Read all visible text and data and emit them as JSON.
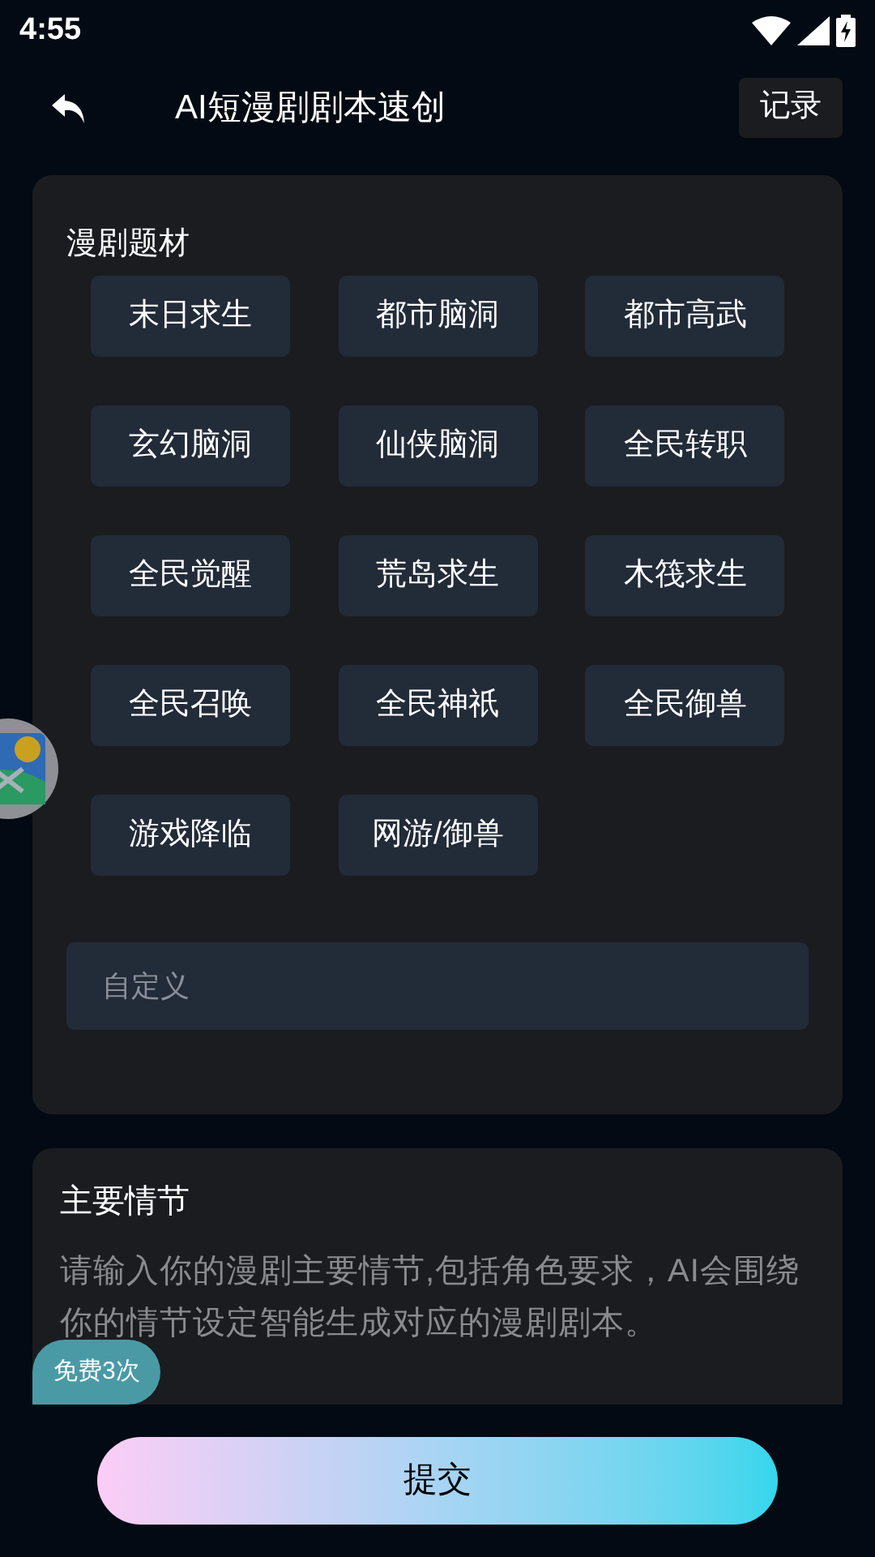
{
  "status_bar": {
    "time": "4:55"
  },
  "header": {
    "title": "AI短漫剧剧本速创",
    "records_button": "记录"
  },
  "genre_card": {
    "title": "漫剧题材",
    "genres": [
      "末日求生",
      "都市脑洞",
      "都市高武",
      "玄幻脑洞",
      "仙侠脑洞",
      "全民转职",
      "全民觉醒",
      "荒岛求生",
      "木筏求生",
      "全民召唤",
      "全民神祇",
      "全民御兽",
      "游戏降临",
      "网游/御兽"
    ],
    "custom_field": {
      "placeholder": "自定义"
    }
  },
  "plot_card": {
    "title": "主要情节",
    "plot_field": {
      "placeholder": "请输入你的漫剧主要情节,包括角色要求，AI会围绕你的情节设定智能生成对应的漫剧剧本。"
    },
    "free_badge": "免费3次"
  },
  "submit_button": "提交"
}
